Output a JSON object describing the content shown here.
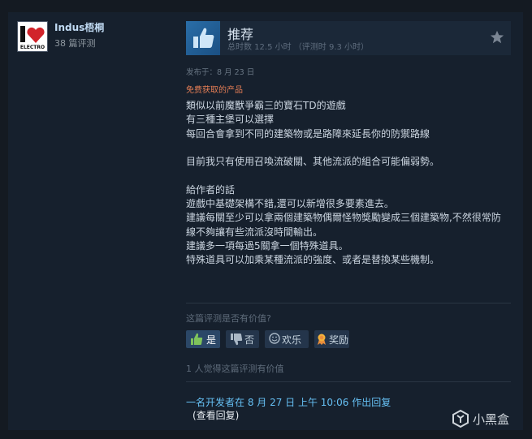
{
  "author": {
    "avatar_name": "electro-heart-avatar",
    "avatar_text": "ELECTRO",
    "name": "Indus梧桐",
    "review_count": "38 篇评测"
  },
  "review": {
    "recommendation": "推荐",
    "hours": "总时数 12.5 小时  （评测时 9.3 小时）",
    "posted": "发布于：8 月 23 日",
    "free_label": "免费获取的产品",
    "body": "類似以前魔獸爭霸三的寶石TD的遊戲\n有三種主堡可以選擇\n每回合會拿到不同的建築物或是路障來延長你的防禦路線\n\n目前我只有使用召喚流破關、其他流派的組合可能偏弱勢。\n\n給作者的話\n遊戲中基礎架構不錯,還可以新增很多要素進去。\n建議每關至少可以拿兩個建築物偶爾怪物獎勵變成三個建築物,不然很常防線不夠讓有些流派沒時間輸出。\n建議多一項每過5關拿一個特殊道具。\n特殊道具可以加乘某種流派的強度、或者是替換某些機制。"
  },
  "helpful": {
    "question": "这篇评测是否有价值?",
    "yes": "是",
    "no": "否",
    "funny": "欢乐",
    "award": "奖励",
    "count_text": "1 人觉得这篇评测有价值"
  },
  "developer": {
    "reply_text": "一名开发者在 8 月 27 日 上午 10:06 作出回复",
    "view_reply": "(查看回复)"
  },
  "watermark": {
    "text": "小黑盒"
  },
  "colors": {
    "accent": "#66c0f4",
    "free_label": "#e67e55",
    "card_bg": "#16202d"
  }
}
